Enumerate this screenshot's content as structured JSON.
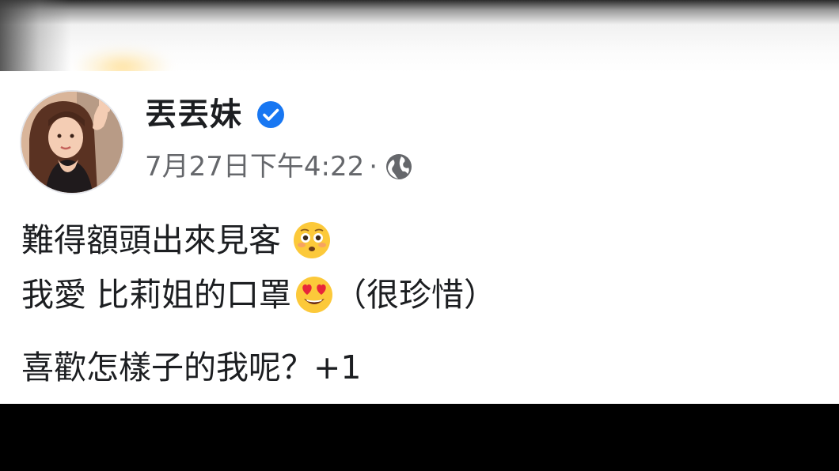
{
  "post": {
    "author": "丟丟妹",
    "verified_icon": "verified-badge-icon",
    "timestamp": "7月27日下午4:22",
    "separator": "·",
    "privacy_icon": "globe-icon",
    "lines": [
      "難得額頭出來見客",
      "我愛 比莉姐的口罩",
      "（很珍惜）",
      "喜歡怎樣子的我呢？+1"
    ],
    "emojis": [
      "flushed-face-emoji",
      "heart-eyes-emoji"
    ]
  },
  "colors": {
    "verified": "#1877f2",
    "meta_text": "#65676b",
    "body_text": "#1c1e21",
    "emoji_face": "#fcc93a"
  }
}
